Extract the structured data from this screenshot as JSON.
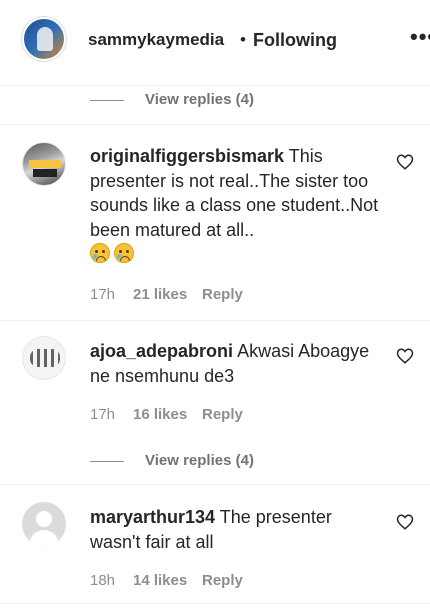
{
  "header": {
    "username": "sammykaymedia",
    "separator": "•",
    "follow_status": "Following",
    "more_icon": "more-dots-icon"
  },
  "reply_rows": [
    {
      "label": "View replies (4)"
    },
    {
      "label": "View replies (4)"
    }
  ],
  "comments": [
    {
      "username": "originalfiggersbismark",
      "text": "This presenter is not real..The sister too sounds like a class one student..Not been matured at all..",
      "emojis": [
        "crying-face-emoji",
        "crying-face-emoji"
      ],
      "time": "17h",
      "likes": "21 likes",
      "reply": "Reply"
    },
    {
      "username": "ajoa_adepabroni",
      "text": "Akwasi Aboagye ne nsemhunu de3",
      "time": "17h",
      "likes": "16 likes",
      "reply": "Reply"
    },
    {
      "username": "maryarthur134",
      "text": "The presenter wasn't fair at all",
      "time": "18h",
      "likes": "14 likes",
      "reply": "Reply"
    }
  ],
  "colors": {
    "text": "#262626",
    "secondary": "#8e8e8e",
    "divider": "#efefef"
  }
}
